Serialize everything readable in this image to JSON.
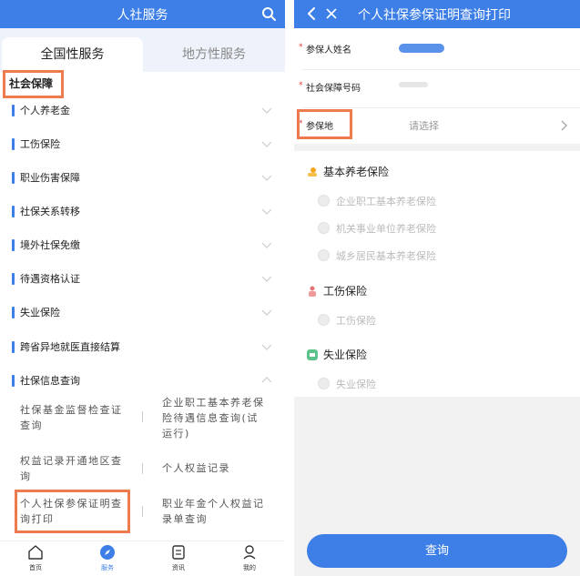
{
  "left": {
    "header_title": "人社服务",
    "tabs": [
      "全国性服务",
      "地方性服务"
    ],
    "section_title": "社会保障",
    "items": [
      "个人养老金",
      "工伤保险",
      "职业伤害保障",
      "社保关系转移",
      "境外社保免缴",
      "待遇资格认证",
      "失业保险",
      "跨省异地就医直接结算",
      "社保信息查询"
    ],
    "sub_items": [
      "社保基金监督检查证查询",
      "企业职工基本养老保险待遇信息查询(试运行)",
      "权益记录开通地区查询",
      "个人权益记录",
      "个人社保参保证明查询打印",
      "职业年金个人权益记录单查询"
    ],
    "nav": [
      "首页",
      "服务",
      "资讯",
      "我的"
    ]
  },
  "right": {
    "header_title": "个人社保参保证明查询打印",
    "fields": [
      {
        "required": "*",
        "label": "参保人姓名"
      },
      {
        "required": "*",
        "label": "社会保障号码"
      },
      {
        "required": "*",
        "label": "参保地",
        "placeholder": "请选择"
      }
    ],
    "groups": [
      {
        "title": "基本养老保险",
        "options": [
          "企业职工基本养老保险",
          "机关事业单位养老保险",
          "城乡居民基本养老保险"
        ]
      },
      {
        "title": "工伤保险",
        "options": [
          "工伤保险"
        ]
      },
      {
        "title": "失业保险",
        "options": [
          "失业保险"
        ]
      }
    ],
    "submit_label": "查询"
  },
  "colors": {
    "primary": "#3d7fe6",
    "highlight": "#ee7b4e",
    "required": "#e53935"
  }
}
